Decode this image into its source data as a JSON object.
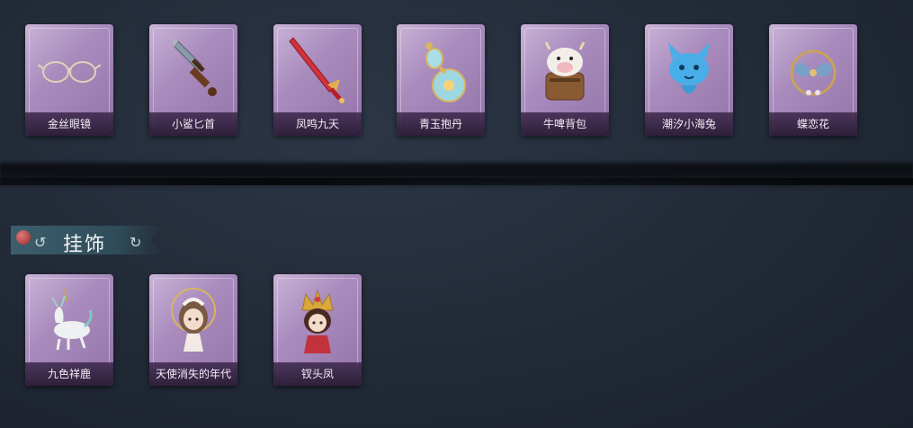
{
  "top_row": [
    {
      "name": "金丝眼镜",
      "icon": "glasses-icon"
    },
    {
      "name": "小鲨匕首",
      "icon": "shark-dagger-icon"
    },
    {
      "name": "凤鸣九天",
      "icon": "red-sword-icon"
    },
    {
      "name": "青玉抱丹",
      "icon": "jade-gourd-icon"
    },
    {
      "name": "牛啤背包",
      "icon": "cow-backpack-icon"
    },
    {
      "name": "潮汐小海兔",
      "icon": "blue-sea-rabbit-icon"
    },
    {
      "name": "蝶恋花",
      "icon": "butterfly-charm-icon"
    }
  ],
  "section": {
    "title": "挂饰"
  },
  "bottom_row": [
    {
      "name": "九色祥鹿",
      "icon": "deer-charm-icon"
    },
    {
      "name": "天使消失的年代",
      "icon": "angel-doll-icon"
    },
    {
      "name": "钗头凤",
      "icon": "phoenix-crown-doll-icon"
    }
  ]
}
